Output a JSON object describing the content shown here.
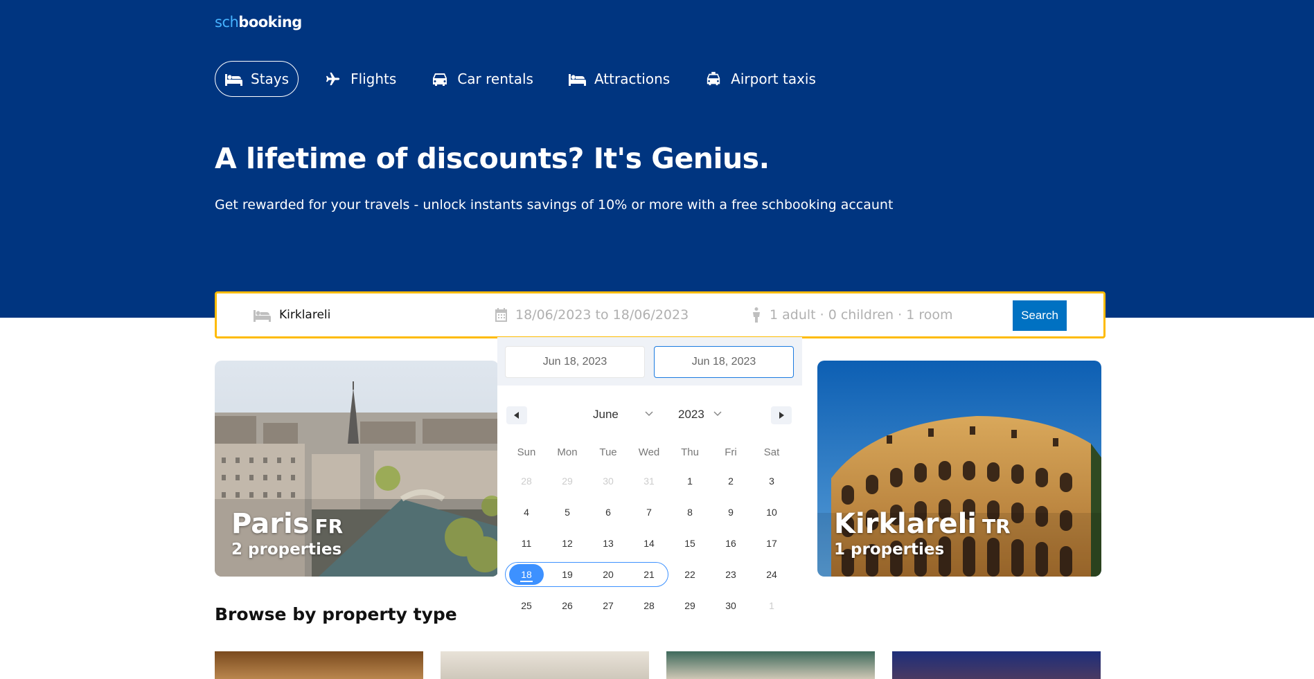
{
  "logo": {
    "accent": "sch",
    "main": "booking"
  },
  "nav": [
    {
      "label": "Stays",
      "icon": "bed-icon",
      "active": true
    },
    {
      "label": "Flights",
      "icon": "plane-icon"
    },
    {
      "label": "Car rentals",
      "icon": "car-icon"
    },
    {
      "label": "Attractions",
      "icon": "bed-icon"
    },
    {
      "label": "Airport taxis",
      "icon": "taxi-icon"
    }
  ],
  "hero": {
    "title": "A lifetime of discounts? It's Genius.",
    "subtitle": "Get rewarded for your travels - unlock instants savings of 10% or more with a free schbooking accaunt"
  },
  "search": {
    "destination": "Kirklareli",
    "dates": "18/06/2023 to 18/06/2023",
    "people": "1 adult · 0 children · 1 room",
    "button": "Search"
  },
  "datepicker": {
    "start_input": "Jun 18, 2023",
    "end_input": "Jun 18, 2023",
    "month": "June",
    "year": "2023",
    "weekdays": [
      "Sun",
      "Mon",
      "Tue",
      "Wed",
      "Thu",
      "Fri",
      "Sat"
    ],
    "weeks": [
      [
        "28",
        "29",
        "30",
        "31",
        "1",
        "2",
        "3"
      ],
      [
        "4",
        "5",
        "6",
        "7",
        "8",
        "9",
        "10"
      ],
      [
        "11",
        "12",
        "13",
        "14",
        "15",
        "16",
        "17"
      ],
      [
        "18",
        "19",
        "20",
        "21",
        "22",
        "23",
        "24"
      ],
      [
        "25",
        "26",
        "27",
        "28",
        "29",
        "30",
        "1"
      ]
    ],
    "selected_day": "18"
  },
  "cards": [
    {
      "city": "Paris",
      "country": "FR",
      "properties": "2 properties"
    },
    {
      "city": "Kirklareli",
      "country": "TR",
      "properties": "1 properties"
    }
  ],
  "browse": {
    "title": "Browse by property type"
  },
  "colors": {
    "brand": "#003580",
    "accent": "#0071c2",
    "highlight": "#febb02",
    "selected": "#3d91ff"
  }
}
